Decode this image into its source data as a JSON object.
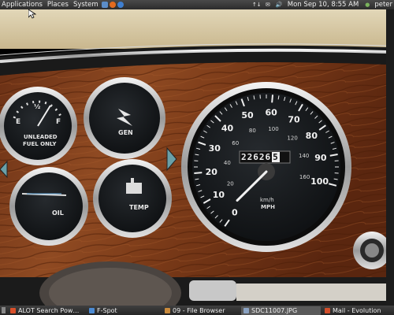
{
  "top_panel": {
    "menus": [
      "Applications",
      "Places",
      "System"
    ],
    "launchers": [
      {
        "icon": "files-launcher-icon",
        "color": "#5b8dc8"
      },
      {
        "icon": "firefox-icon",
        "color": "#e36b1f"
      },
      {
        "icon": "help-icon",
        "color": "#3f7fd0"
      }
    ],
    "network_icon": "↑↓",
    "mail_icon": "✉",
    "volume_icon": "🔊",
    "clock": "Mon Sep 10,  8:55 AM",
    "user": "peter",
    "user_icon": "●"
  },
  "dashboard": {
    "fuel_labels": [
      "UNLEADED",
      "FUEL ONLY"
    ],
    "fuel_scale": [
      "E",
      "½",
      "F"
    ],
    "gen_label": "GEN",
    "oil_label": "OIL",
    "temp_label": "TEMP",
    "speed_unit_top": "km/h",
    "speed_unit_bottom": "MPH",
    "odometer": "22626",
    "odometer_tenth": "5",
    "mph_ticks": [
      "0",
      "10",
      "20",
      "30",
      "40",
      "50",
      "60",
      "70",
      "80",
      "90",
      "100"
    ],
    "kmh_ticks": [
      "20",
      "40",
      "60",
      "80",
      "100",
      "120",
      "140",
      "160"
    ],
    "speed_mph": 0
  },
  "bottom_panel": {
    "tasks": [
      {
        "label": "ALOT Search Pow…",
        "icon_color": "#d9502a"
      },
      {
        "label": "F-Spot",
        "icon_color": "#4c8bd4"
      },
      {
        "label": "09 - File Browser",
        "icon_color": "#c98a3c"
      },
      {
        "label": "SDC11007.JPG",
        "icon_color": "#8aa2c2"
      },
      {
        "label": "Mail - Evolution",
        "icon_color": "#d24e2a"
      }
    ]
  }
}
